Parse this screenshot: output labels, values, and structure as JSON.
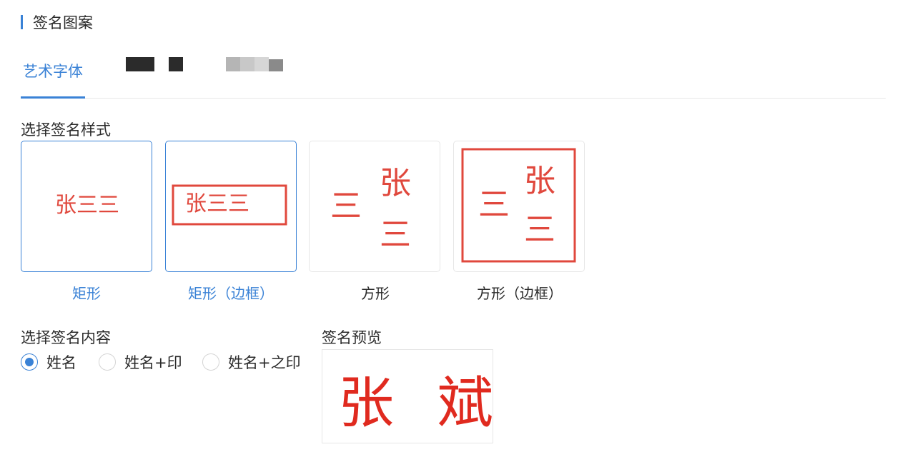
{
  "section": {
    "title": "签名图案"
  },
  "tabs": {
    "active_label": "艺术字体"
  },
  "style_section": {
    "label": "选择签名样式"
  },
  "styles": [
    {
      "caption": "矩形",
      "sample": "张三三",
      "selected": true
    },
    {
      "caption": "矩形（边框）",
      "sample": "张三三",
      "selected": true
    },
    {
      "caption": "方形",
      "chars": [
        "张",
        "三",
        "三"
      ],
      "selected": false
    },
    {
      "caption": "方形（边框）",
      "chars": [
        "张",
        "三",
        "三"
      ],
      "selected": false
    }
  ],
  "content_section": {
    "label": "选择签名内容",
    "options": [
      "姓名",
      "姓名+印",
      "姓名+之印"
    ],
    "selected": "姓名"
  },
  "preview": {
    "label": "签名预览",
    "text": "张 斌"
  },
  "colors": {
    "accent": "#3a82d6",
    "seal_red": "#e0483d",
    "preview_red": "#e02a1f"
  }
}
